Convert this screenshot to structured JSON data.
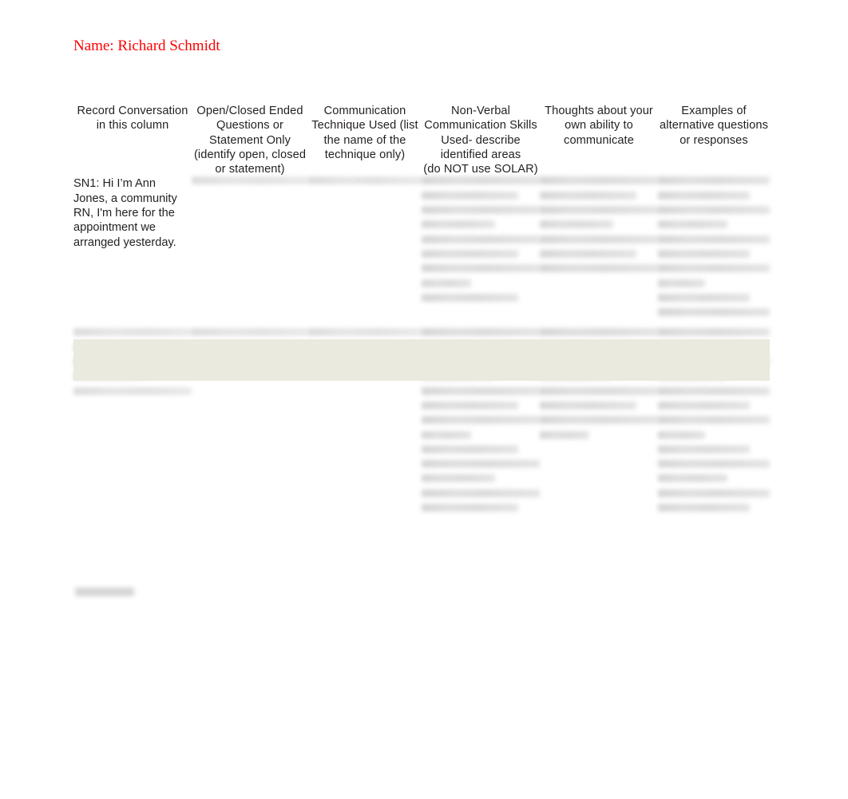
{
  "document": {
    "name_line": "Name: Richard Schmidt",
    "accent_color": "#fe0000",
    "text_color": "#231f20",
    "page_background": "#ffffff",
    "highlight_band_color": "#eaeade"
  },
  "table": {
    "headers": [
      "Record Conversation\nin this column",
      "Open/Closed Ended\nQuestions or\nStatement Only\n(identify open, closed\nor statement)",
      "Communication\nTechnique Used (list\nthe name of the\ntechnique only)",
      "Non-Verbal\nCommunication Skills\nUsed- describe\nidentified areas\n(do NOT use SOLAR)",
      "Thoughts about your\nown ability to\ncommunicate",
      "Examples of\nalternative questions\nor responses"
    ],
    "rows": [
      {
        "cells": [
          {
            "readable": true,
            "text": "SN1: Hi I’m Ann\nJones, a community\nRN, I'm here for the\nappointment we\narranged yesterday."
          },
          {
            "readable": false,
            "lines": 1,
            "density": "normal"
          },
          {
            "readable": false,
            "lines": 1,
            "density": "normal"
          },
          {
            "readable": false,
            "lines": 9,
            "density": "dense"
          },
          {
            "readable": false,
            "lines": 7,
            "density": "dense"
          },
          {
            "readable": false,
            "lines": 10,
            "density": "dense"
          }
        ]
      },
      {
        "cells": [
          {
            "readable": false,
            "lines": 5,
            "density": "normal"
          },
          {
            "readable": false,
            "lines": 1,
            "density": "normal"
          },
          {
            "readable": false,
            "lines": 1,
            "density": "normal"
          },
          {
            "readable": false,
            "lines": 13,
            "density": "dense"
          },
          {
            "readable": false,
            "lines": 8,
            "density": "dense"
          },
          {
            "readable": false,
            "lines": 13,
            "density": "dense"
          }
        ]
      }
    ]
  }
}
